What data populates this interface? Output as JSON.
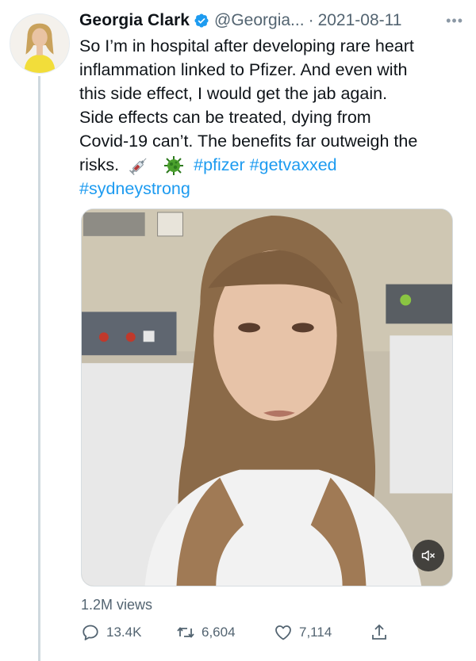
{
  "tweet": {
    "author_name": "Georgia Clark",
    "handle": "@Georgia...",
    "separator": "·",
    "date": "2021-08-11",
    "more_label": "•••",
    "lines": [
      "So I’m in hospital after developing rare heart",
      "inflammation linked to Pfizer. And even with",
      "this side effect, I would get the jab again.",
      "Side effects can be treated, dying from",
      "Covid-19 can’t. The benefits far outweigh the"
    ],
    "last_line_text": "risks.",
    "emojis": [
      "syringe-emoji",
      "microbe-emoji"
    ],
    "hashtags": [
      "#pfizer",
      "#getvaxxed",
      "#sydneystrong"
    ],
    "views": "1.2M views",
    "stats": {
      "replies": "13.4K",
      "retweets": "6,604",
      "likes": "7,114"
    }
  },
  "icons": {
    "verified": "verified-badge-icon",
    "reply": "speech-bubble-icon",
    "retweet": "retweet-arrows-icon",
    "like": "heart-icon",
    "share": "share-upload-icon",
    "mute": "speaker-muted-icon"
  },
  "colors": {
    "accent": "#1d9bf0",
    "secondary_text": "#536471",
    "primary_text": "#0f1419",
    "thread_line": "#cfd9de"
  }
}
